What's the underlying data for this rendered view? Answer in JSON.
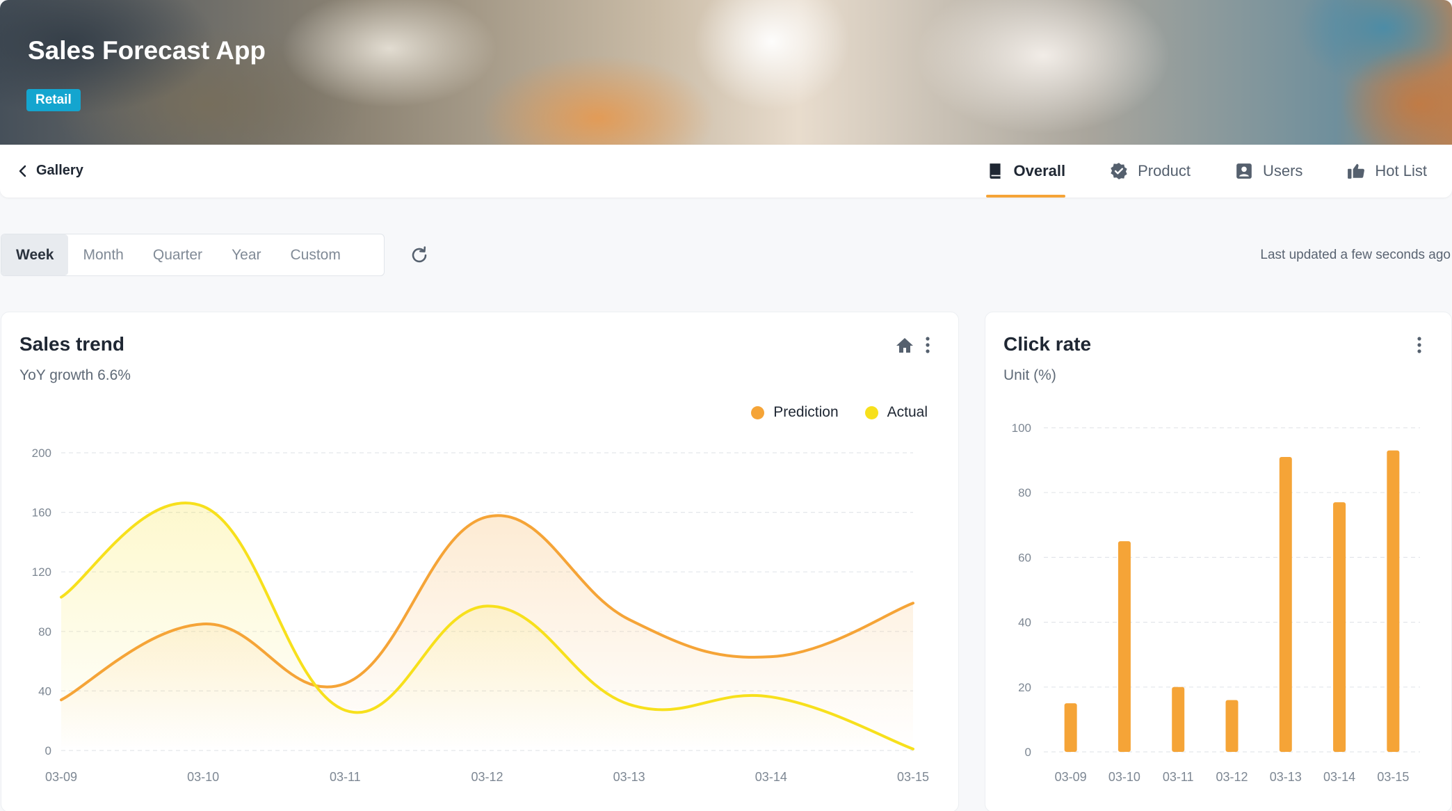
{
  "header": {
    "title": "Sales Forecast App",
    "badge": "Retail"
  },
  "nav": {
    "back_label": "Gallery",
    "tabs": [
      {
        "label": "Overall",
        "icon": "book-icon",
        "active": true
      },
      {
        "label": "Product",
        "icon": "verified-badge-icon",
        "active": false
      },
      {
        "label": "Users",
        "icon": "user-card-icon",
        "active": false
      },
      {
        "label": "Hot List",
        "icon": "thumbs-up-icon",
        "active": false
      }
    ]
  },
  "filters": {
    "periods": [
      "Week",
      "Month",
      "Quarter",
      "Year",
      "Custom"
    ],
    "selected": "Week",
    "last_updated": "Last updated a few seconds ago"
  },
  "colors": {
    "prediction": "#f5a437",
    "actual": "#f7e01c",
    "accent": "#f5a437",
    "badge": "#14a5cf"
  },
  "sales_card": {
    "title": "Sales trend",
    "subtitle": "YoY growth 6.6%",
    "legend": [
      "Prediction",
      "Actual"
    ]
  },
  "click_card": {
    "title": "Click rate",
    "subtitle": "Unit (%)"
  },
  "chart_data": [
    {
      "type": "area",
      "title": "Sales trend",
      "categories": [
        "03-09",
        "03-10",
        "03-11",
        "03-12",
        "03-13",
        "03-14",
        "03-15"
      ],
      "ylim": [
        0,
        200
      ],
      "yticks": [
        0,
        40,
        80,
        120,
        160,
        200
      ],
      "grid": true,
      "legend_position": "top-right",
      "series": [
        {
          "name": "Prediction",
          "values": [
            34,
            85,
            45,
            157,
            88,
            63,
            99
          ]
        },
        {
          "name": "Actual",
          "values": [
            103,
            164,
            27,
            97,
            31,
            36,
            1
          ]
        }
      ]
    },
    {
      "type": "bar",
      "title": "Click rate",
      "categories": [
        "03-09",
        "03-10",
        "03-11",
        "03-12",
        "03-13",
        "03-14",
        "03-15"
      ],
      "values": [
        15,
        65,
        20,
        16,
        91,
        77,
        93
      ],
      "ylim": [
        0,
        100
      ],
      "yticks": [
        0,
        20,
        40,
        60,
        80,
        100
      ],
      "grid": true
    }
  ]
}
